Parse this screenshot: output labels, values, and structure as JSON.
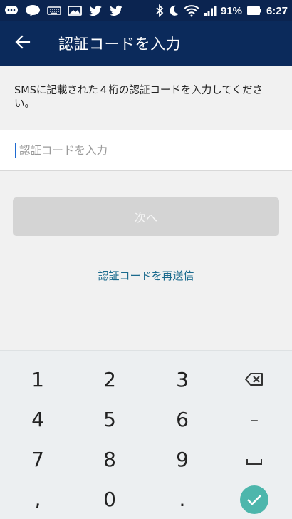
{
  "status_bar": {
    "left_icons": [
      "chat-bubble-icon",
      "line-app-icon",
      "keyboard-icon",
      "image-icon",
      "twitter-bird-icon",
      "twitter-bird-icon"
    ],
    "right_icons": [
      "bluetooth-icon",
      "moon-icon",
      "wifi-icon",
      "signal-icon",
      "battery-icon"
    ],
    "battery": "91%",
    "time": "6:27"
  },
  "app_bar": {
    "back_icon": "arrow-back-icon",
    "title": "認証コードを入力"
  },
  "instruction": "SMSに記載された４桁の認証コードを入力してください。",
  "code_field": {
    "placeholder": "認証コードを入力",
    "value": ""
  },
  "next_button": {
    "label": "次へ",
    "enabled": false
  },
  "resend_link": "認証コードを再送信",
  "keyboard": {
    "keys": [
      "1",
      "2",
      "3",
      "backspace-icon",
      "4",
      "5",
      "6",
      "–",
      "7",
      "8",
      "9",
      "space-icon",
      ",",
      "0",
      ".",
      "done-check-icon"
    ],
    "done_color": "#4db6ac"
  },
  "colors": {
    "status_bar": "#0b2450",
    "app_bar": "#0b2a5b",
    "link": "#1b6a8d",
    "button_disabled": "#d4d4d4"
  }
}
